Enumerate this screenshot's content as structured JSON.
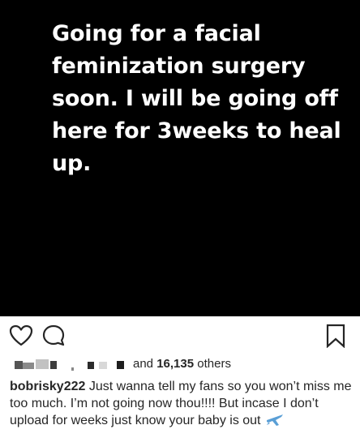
{
  "post": {
    "overlay_text": "Going for a facial feminization surgery soon. I will be going off here for 3weeks to heal up."
  },
  "actions": {
    "like_icon": "heart-outline-icon",
    "comment_icon": "comment-bubble-icon",
    "save_icon": "bookmark-outline-icon"
  },
  "likes": {
    "prefix": "and",
    "count": "16,135",
    "suffix": "others"
  },
  "caption": {
    "username": "bobrisky222",
    "text": "Just wanna tell my fans so you won’t miss me too much. I’m not going now thou!!!! But incase I don’t upload for weeks just know your baby is out",
    "emoji_icon": "airplane-icon"
  },
  "colors": {
    "post_background": "#000000",
    "post_text": "#ffffff",
    "ui_text": "#262626",
    "emoji_blue": "#5a9fd6"
  }
}
